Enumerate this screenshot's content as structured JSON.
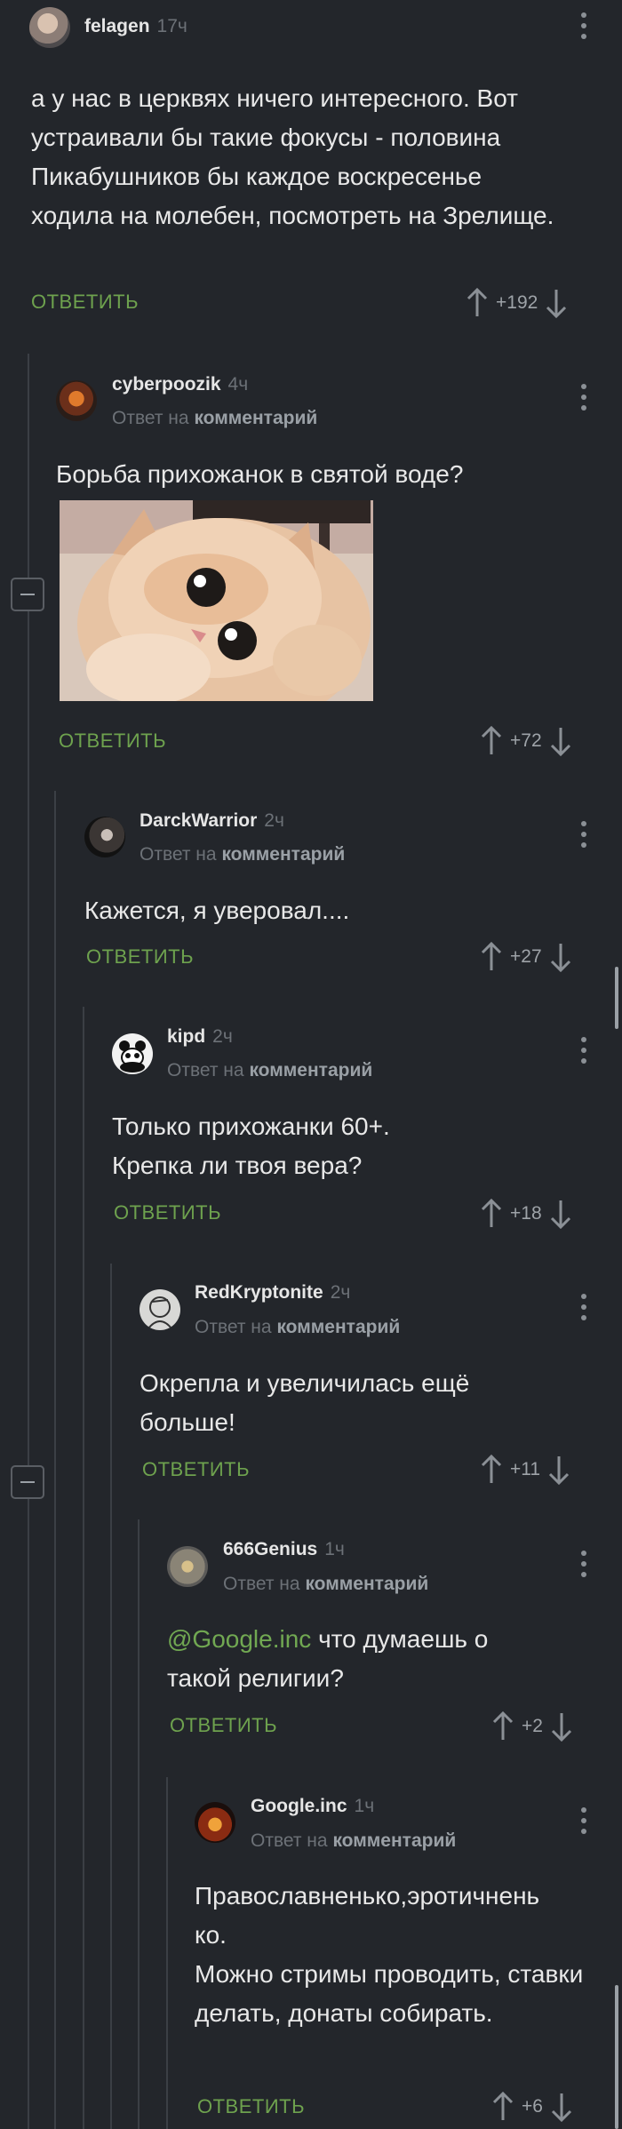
{
  "comments": [
    {
      "author": "felagen",
      "time": "17ч",
      "reply_prefix": "",
      "reply_target": "",
      "text": "а у нас в церквях ничего интересного. Вот устраивали бы такие фокусы - половина Пикабушников бы каждое воскресенье ходила на молебен, посмотреть на Зрелище.",
      "reply_label": "ОТВЕТИТЬ",
      "rating": "+192"
    },
    {
      "author": "cyberpoozik",
      "time": "4ч",
      "reply_prefix": "Ответ на",
      "reply_target": "комментарий",
      "text": "Борьба прихожанок в святой воде?",
      "reply_label": "ОТВЕТИТЬ",
      "rating": "+72"
    },
    {
      "author": "DarckWarrior",
      "time": "2ч",
      "reply_prefix": "Ответ на",
      "reply_target": "комментарий",
      "text": "Кажется, я уверовал....",
      "reply_label": "ОТВЕТИТЬ",
      "rating": "+27"
    },
    {
      "author": "kipd",
      "time": "2ч",
      "reply_prefix": "Ответ на",
      "reply_target": "комментарий",
      "text": "Только прихожанки 60+. Крепка ли твоя вера?",
      "reply_label": "ОТВЕТИТЬ",
      "rating": "+18"
    },
    {
      "author": "RedKryptonite",
      "time": "2ч",
      "reply_prefix": "Ответ на",
      "reply_target": "комментарий",
      "text": "Окрепла и увеличилась ещё больше!",
      "reply_label": "ОТВЕТИТЬ",
      "rating": "+11"
    },
    {
      "author": "666Genius",
      "time": "1ч",
      "reply_prefix": "Ответ на",
      "reply_target": "комментарий",
      "mention": "@Google.inc",
      "text": " что думаешь о такой религии?",
      "reply_label": "ОТВЕТИТЬ",
      "rating": "+2"
    },
    {
      "author": "Google.inc",
      "time": "1ч",
      "reply_prefix": "Ответ на",
      "reply_target": "комментарий",
      "text_line1": "Православненько,эротичнень",
      "text_line2": "ко.",
      "text_line3": "Можно стримы проводить, ставки делать, донаты собирать.",
      "reply_label": "ОТВЕТИТЬ",
      "rating": "+6"
    }
  ],
  "icons": {
    "upvote": "arrow-up-icon",
    "downvote": "arrow-down-icon",
    "more": "kebab-menu-icon",
    "collapse": "collapse-thread-icon"
  },
  "colors": {
    "background": "#23262b",
    "accent_green": "#6ea24e",
    "muted": "#6c7177",
    "thread_line": "#3b3f45"
  }
}
